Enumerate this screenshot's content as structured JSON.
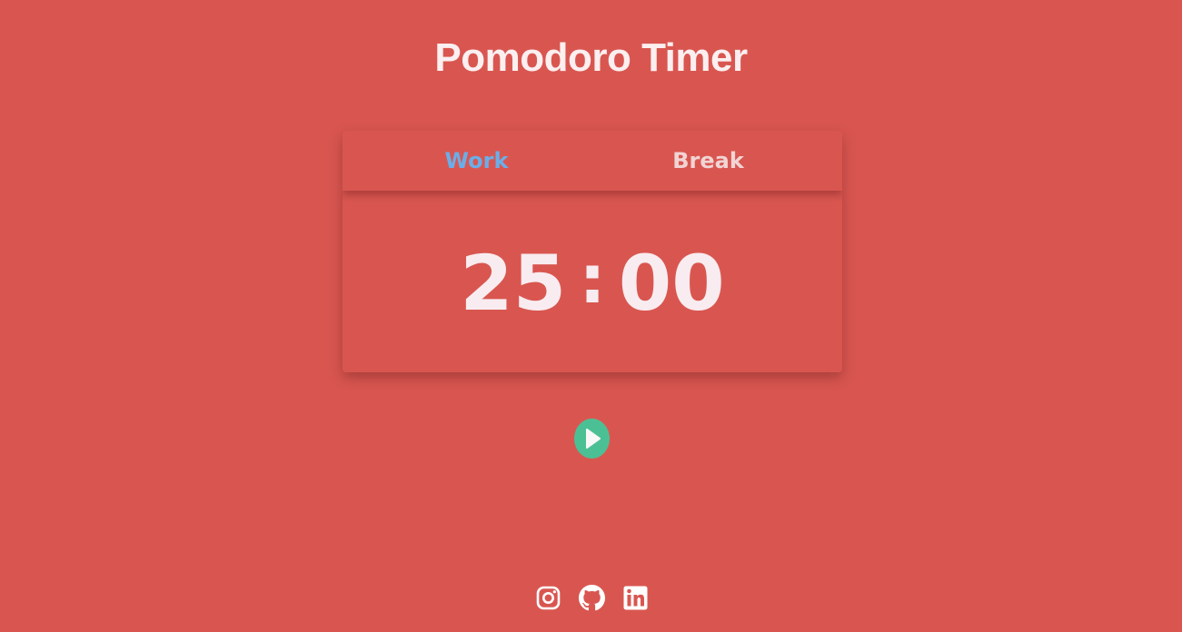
{
  "page": {
    "title": "Pomodoro Timer"
  },
  "tabs": [
    {
      "label": "Work",
      "active": true
    },
    {
      "label": "Break",
      "active": false
    }
  ],
  "timer": {
    "minutes": "25",
    "separator": ":",
    "seconds": "00"
  },
  "controls": {
    "play_icon": "play-icon"
  },
  "social": [
    {
      "icon": "instagram-icon"
    },
    {
      "icon": "github-icon"
    },
    {
      "icon": "linkedin-icon"
    }
  ],
  "colors": {
    "background": "#d95650",
    "active_tab": "#6aaee8",
    "inactive_tab": "#f1d4d4",
    "play_button": "#4cc095",
    "text": "#f8ecf0"
  }
}
